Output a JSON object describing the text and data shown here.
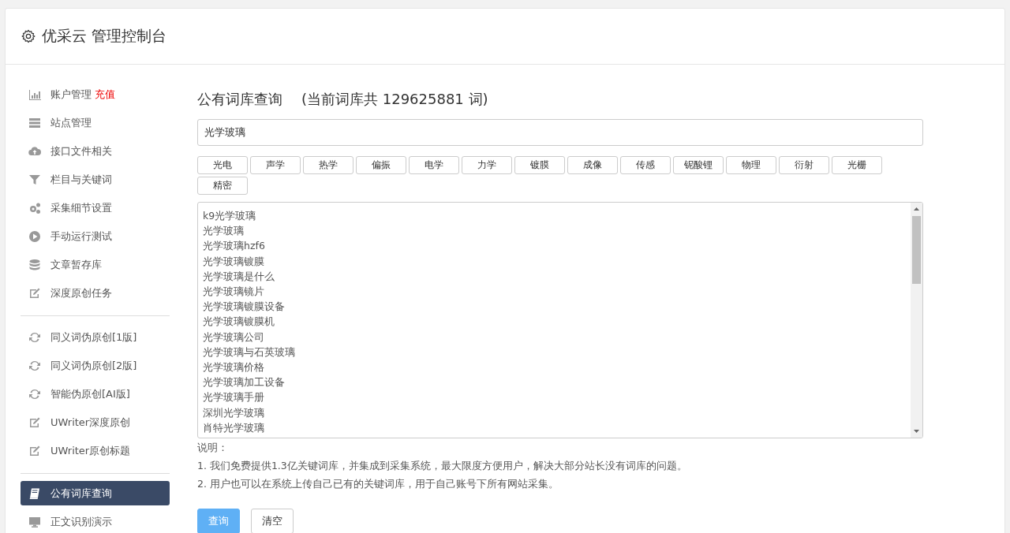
{
  "header": {
    "title": "优采云 管理控制台"
  },
  "sidebar": {
    "groups": [
      [
        {
          "label": "账户管理",
          "badge": "充值",
          "selected": false
        },
        {
          "label": "站点管理",
          "selected": false
        },
        {
          "label": "接口文件相关",
          "selected": false
        },
        {
          "label": "栏目与关键词",
          "selected": false
        },
        {
          "label": "采集细节设置",
          "selected": false
        },
        {
          "label": "手动运行测试",
          "selected": false
        },
        {
          "label": "文章暂存库",
          "selected": false
        },
        {
          "label": "深度原创任务",
          "selected": false
        }
      ],
      [
        {
          "label": "同义词伪原创[1版]",
          "selected": false
        },
        {
          "label": "同义词伪原创[2版]",
          "selected": false
        },
        {
          "label": "智能伪原创[AI版]",
          "selected": false
        },
        {
          "label": "UWriter深度原创",
          "selected": false
        },
        {
          "label": "UWriter原创标题",
          "selected": false
        }
      ],
      [
        {
          "label": "公有词库查询",
          "selected": true
        },
        {
          "label": "正文识别演示",
          "selected": false
        }
      ]
    ]
  },
  "main": {
    "title": "公有词库查询",
    "count_text": "(当前词库共 129625881 词)",
    "search": {
      "value": "光学玻璃"
    },
    "tags": [
      "光电",
      "声学",
      "热学",
      "偏振",
      "电学",
      "力学",
      "镀膜",
      "成像",
      "传感",
      "铌酸锂",
      "物理",
      "衍射",
      "光栅",
      "精密"
    ],
    "results": [
      "k9光学玻璃",
      "光学玻璃",
      "光学玻璃hzf6",
      "光学玻璃镀膜",
      "光学玻璃是什么",
      "光学玻璃镜片",
      "光学玻璃镀膜设备",
      "光学玻璃镀膜机",
      "光学玻璃公司",
      "光学玻璃与石英玻璃",
      "光学玻璃价格",
      "光学玻璃加工设备",
      "光学玻璃手册",
      "深圳光学玻璃",
      "肖特光学玻璃"
    ],
    "notes_title": "说明：",
    "notes": [
      "1. 我们免费提供1.3亿关键词库，并集成到采集系统，最大限度方便用户，解决大部分站长没有词库的问题。",
      "2. 用户也可以在系统上传自己已有的关键词库，用于自己账号下所有网站采集。"
    ],
    "buttons": [
      {
        "label": "查询",
        "kind": "primary"
      },
      {
        "label": "清空",
        "kind": "default"
      }
    ]
  }
}
